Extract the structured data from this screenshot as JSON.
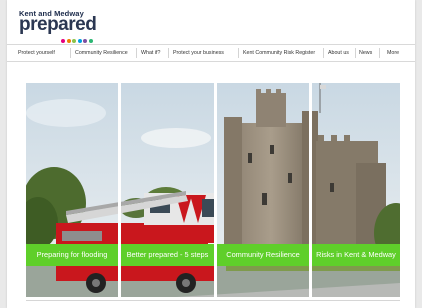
{
  "brand": {
    "line1": "Kent and Medway",
    "line2": "prepared",
    "dot_colors": [
      "#e6007e",
      "#ef7d00",
      "#8bc34a",
      "#00a0e3",
      "#7b4fa2",
      "#2bb673"
    ]
  },
  "nav": {
    "items": [
      "Protect yourself",
      "Community Resilience",
      "What if?",
      "Protect your business",
      "Kent Community Risk Register",
      "About us",
      "News",
      "More"
    ]
  },
  "hero": {
    "panels": [
      "Preparing for flooding",
      "Better prepared - 5 steps",
      "Community Resilience",
      "Risks in Kent & Medway"
    ],
    "accent_color": "#5fcf2a"
  }
}
